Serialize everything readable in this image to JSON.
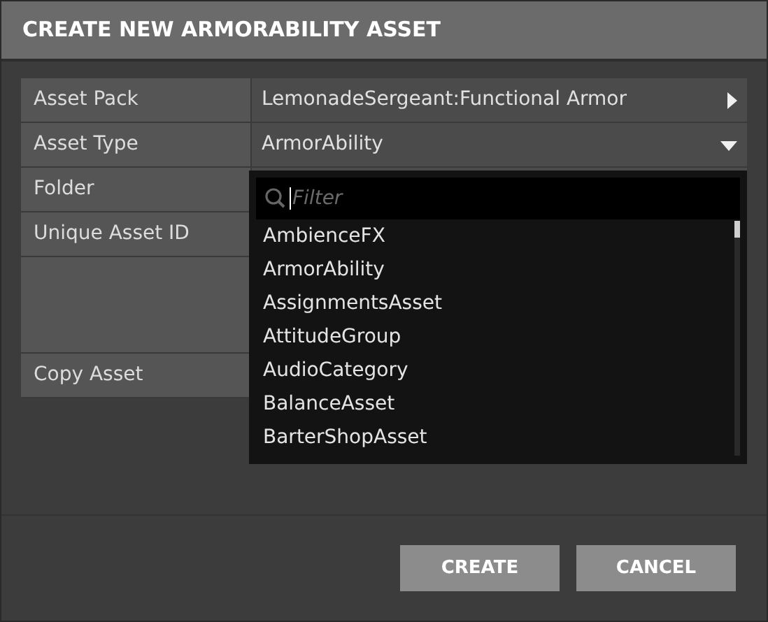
{
  "window": {
    "title": "CREATE NEW ARMORABILITY ASSET"
  },
  "fields": [
    {
      "label": "Asset Pack",
      "value": "LemonadeSergeant:Functional Armor",
      "kind": "submenu"
    },
    {
      "label": "Asset Type",
      "value": "ArmorAbility",
      "kind": "dropdown"
    },
    {
      "label": "Folder",
      "kind": "plain"
    },
    {
      "label": "Unique Asset ID",
      "kind": "plain"
    },
    {
      "kind": "tall"
    },
    {
      "label": "Copy Asset",
      "kind": "plain"
    }
  ],
  "dropdown": {
    "filter": {
      "placeholder": "Filter"
    },
    "items": [
      "AmbienceFX",
      "ArmorAbility",
      "AssignmentsAsset",
      "AttitudeGroup",
      "AudioCategory",
      "BalanceAsset",
      "BarterShopAsset"
    ]
  },
  "buttons": [
    "CREATE",
    "CANCEL"
  ]
}
